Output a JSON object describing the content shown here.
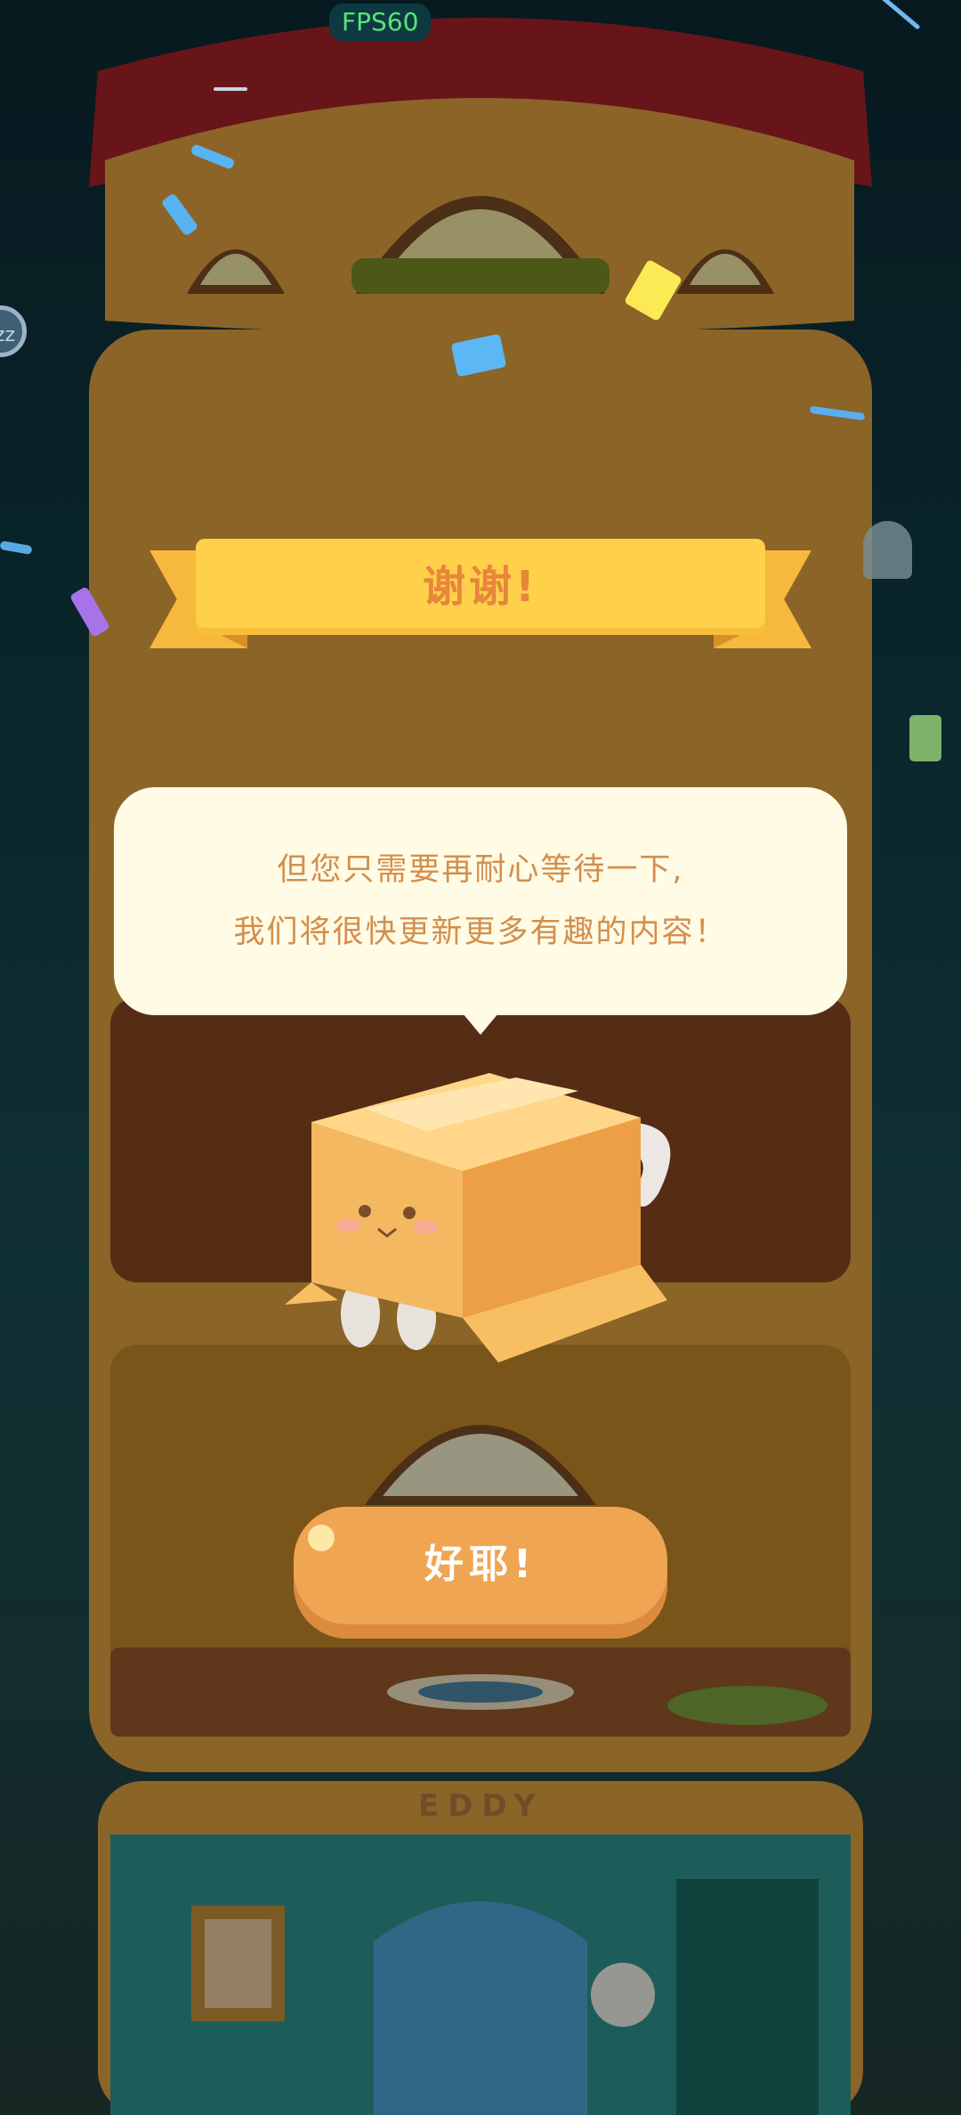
{
  "hud": {
    "fps_label": "FPS60",
    "sleep_label": "zz"
  },
  "ribbon": {
    "title": "谢谢!"
  },
  "message": {
    "line1": "但您只需要再耐心等待一下,",
    "line2": "我们将很快更新更多有趣的内容！"
  },
  "button": {
    "label": "好耶!"
  },
  "tower": {
    "bottom_floor_sign": "EDDY"
  },
  "colors": {
    "ribbon": "#ffd04a",
    "ribbon_text": "#e8863c",
    "bubble": "#fffbe5",
    "bubble_text": "#d38f4e",
    "button": "#f0a552"
  }
}
